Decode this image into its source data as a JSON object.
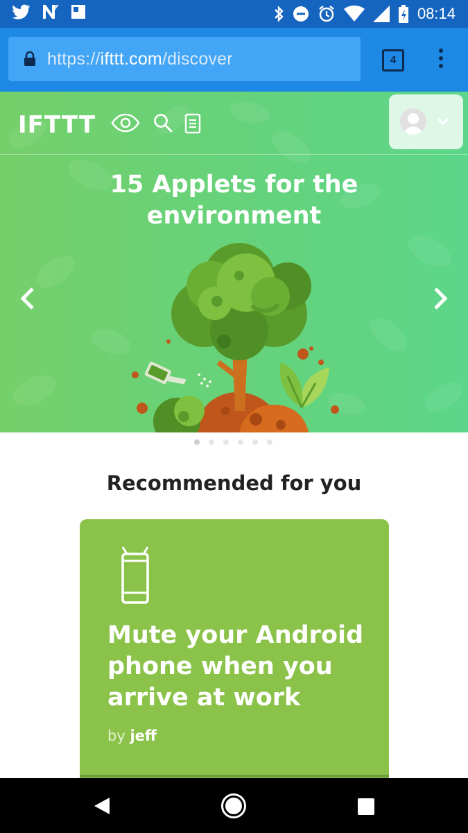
{
  "status_bar": {
    "time": "08:14",
    "left_icons": [
      "twitter-icon",
      "n-icon",
      "photo-icon"
    ],
    "right_icons": [
      "bluetooth-icon",
      "do-not-disturb-icon",
      "alarm-icon",
      "wifi-icon",
      "signal-icon",
      "battery-icon"
    ]
  },
  "browser": {
    "url_scheme": "https://",
    "url_host": "ifttt.com",
    "url_path": "/discover",
    "tab_count": "4"
  },
  "site_nav": {
    "logo": "IFTTT",
    "icons": [
      "eye-icon",
      "search-icon",
      "document-icon"
    ],
    "profile_icons": [
      "avatar",
      "chevron-down-icon"
    ]
  },
  "hero": {
    "title_line1": "15 Applets for the",
    "title_line2": "environment",
    "slide_count": 6,
    "active_slide": 1
  },
  "recommended": {
    "heading": "Recommended for you"
  },
  "card": {
    "icon": "android-phone-icon",
    "title": "Mute your Android phone when you arrive at work",
    "by_label": "by",
    "author": "jeff",
    "color": "#8bc34a"
  },
  "colors": {
    "status_bar": "#1565c0",
    "browser_bar": "#1e88e5",
    "hero_green": "#66d27a",
    "card_green": "#8bc34a"
  }
}
